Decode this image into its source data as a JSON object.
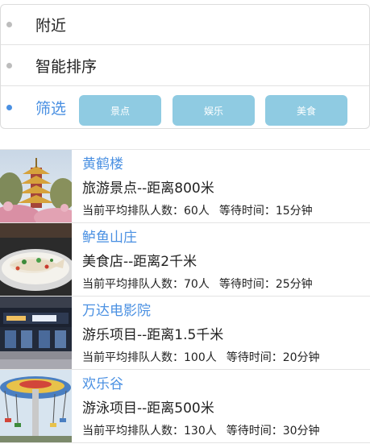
{
  "filters": {
    "nearby": "附近",
    "sort": "智能排序",
    "filter": "筛选",
    "categories": [
      "景点",
      "娱乐",
      "美食"
    ]
  },
  "items": [
    {
      "name": "黄鹤楼",
      "subtitle": "旅游景点--距离800米",
      "queue": "当前平均排队人数：60人",
      "wait": "等待时间：15分钟"
    },
    {
      "name": "鲈鱼山庄",
      "subtitle": "美食店--距离2千米",
      "queue": "当前平均排队人数：70人",
      "wait": "等待时间：25分钟"
    },
    {
      "name": "万达电影院",
      "subtitle": "游乐项目--距离1.5千米",
      "queue": "当前平均排队人数：100人",
      "wait": "等待时间：20分钟"
    },
    {
      "name": "欢乐谷",
      "subtitle": "游泳项目--距离500米",
      "queue": "当前平均排队人数：130人",
      "wait": "等待时间：30分钟"
    }
  ],
  "thumbnails": [
    "pagoda-photo",
    "fish-dish-photo",
    "cinema-lobby-photo",
    "swing-ride-photo"
  ],
  "colors": {
    "accent": "#4a90e2",
    "button_bg": "#8fcbe2",
    "inactive_dot": "#bdbdbd"
  }
}
